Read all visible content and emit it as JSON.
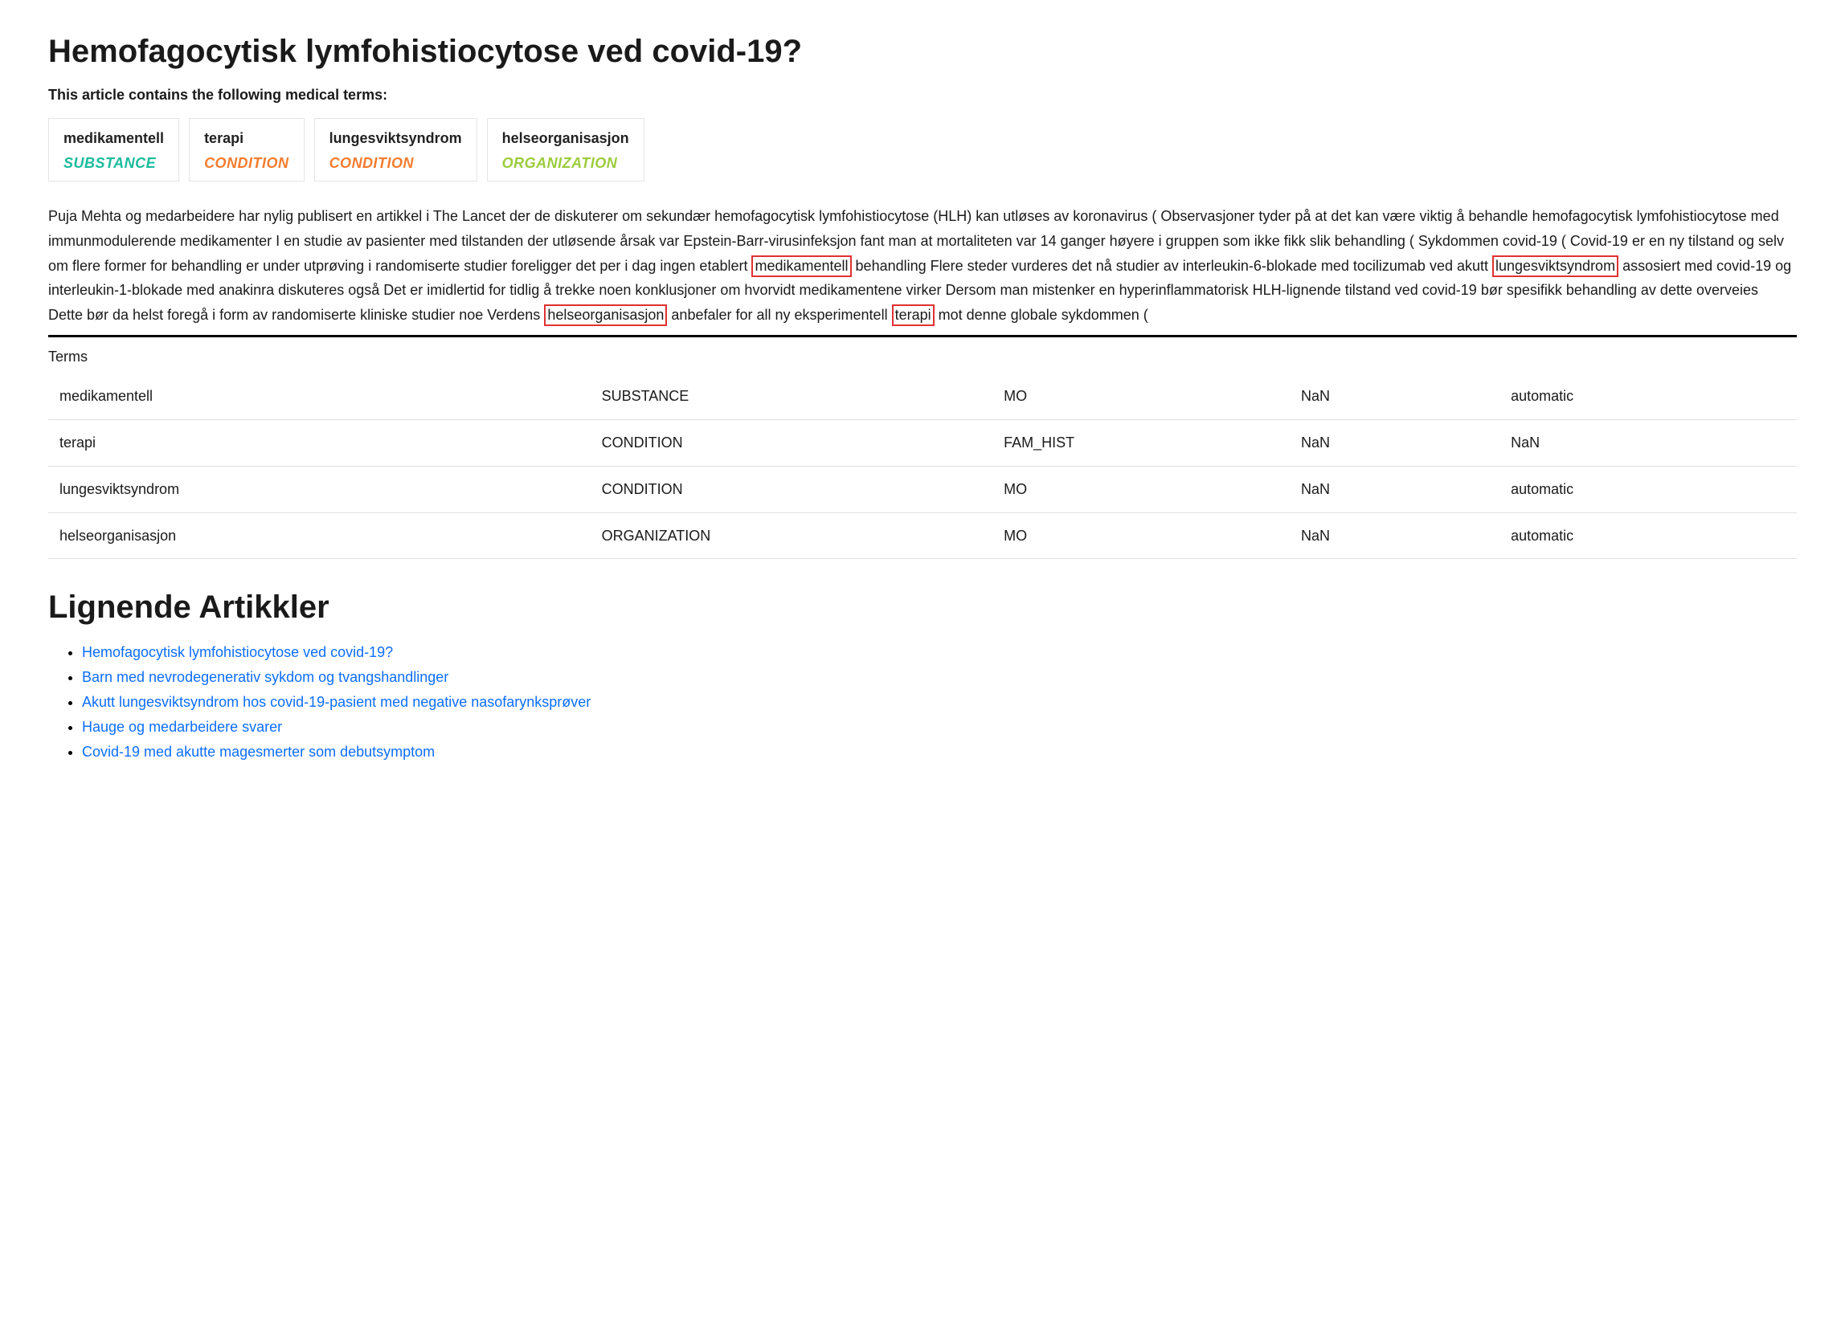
{
  "title": "Hemofagocytisk lymfohistiocytose ved covid-19?",
  "intro_line": "This article contains the following medical terms:",
  "chips": [
    {
      "term": "medikamentell",
      "type": "SUBSTANCE",
      "type_class": "type-substance"
    },
    {
      "term": "terapi",
      "type": "CONDITION",
      "type_class": "type-condition"
    },
    {
      "term": "lungesviktsyndrom",
      "type": "CONDITION",
      "type_class": "type-condition"
    },
    {
      "term": "helseorganisasjon",
      "type": "ORGANIZATION",
      "type_class": "type-organization"
    }
  ],
  "body_segments": [
    {
      "t": "Puja Mehta og medarbeidere har nylig publisert en artikkel i The Lancet der de diskuterer om sekundær hemofagocytisk lymfohistiocytose (HLH) kan utløses av koronavirus ( Observasjoner tyder på at det kan være viktig å behandle hemofagocytisk lymfohistiocytose med immunmodulerende medikamenter I en studie av pasienter med tilstanden der utløsende årsak var Epstein-Barr-virusinfeksjon fant man at mortaliteten var 14 ganger høyere i gruppen som ikke fikk slik behandling ( Sykdommen covid-19 ( Covid-19 er en ny tilstand og selv om flere former for behandling er under utprøving i randomiserte studier foreligger det per i dag ingen etablert ",
      "hl": false
    },
    {
      "t": "medikamentell",
      "hl": true
    },
    {
      "t": " behandling Flere steder vurderes det nå studier av interleukin-6-blokade med tocilizumab ved akutt ",
      "hl": false
    },
    {
      "t": "lungesviktsyndrom",
      "hl": true
    },
    {
      "t": " assosiert med covid-19 og interleukin-1-blokade med anakinra diskuteres også Det er imidlertid for tidlig å trekke noen konklusjoner om hvorvidt medikamentene virker Dersom man mistenker en hyperinflammatorisk HLH-lignende tilstand ved covid-19 bør spesifikk behandling av dette overveies Dette bør da helst foregå i form av randomiserte kliniske studier noe Verdens ",
      "hl": false
    },
    {
      "t": "helseorganisasjon",
      "hl": true
    },
    {
      "t": " anbefaler for all ny eksperimentell ",
      "hl": false
    },
    {
      "t": "terapi",
      "hl": true
    },
    {
      "t": " mot denne globale sykdommen (",
      "hl": false
    }
  ],
  "terms_label": "Terms",
  "terms_rows": [
    {
      "c1": "medikamentell",
      "c2": "SUBSTANCE",
      "c3": "MO",
      "c4": "NaN",
      "c5": "automatic"
    },
    {
      "c1": "terapi",
      "c2": "CONDITION",
      "c3": "FAM_HIST",
      "c4": "NaN",
      "c5": "NaN"
    },
    {
      "c1": "lungesviktsyndrom",
      "c2": "CONDITION",
      "c3": "MO",
      "c4": "NaN",
      "c5": "automatic"
    },
    {
      "c1": "helseorganisasjon",
      "c2": "ORGANIZATION",
      "c3": "MO",
      "c4": "NaN",
      "c5": "automatic"
    }
  ],
  "related_heading": "Lignende Artikkler",
  "related_links": [
    "Hemofagocytisk lymfohistiocytose ved covid-19?",
    "Barn med nevrodegenerativ sykdom og tvangshandlinger",
    "Akutt lungesviktsyndrom hos covid-19-pasient med negative nasofarynksprøver",
    "Hauge og medarbeidere svarer",
    "Covid-19 med akutte magesmerter som debutsymptom"
  ]
}
